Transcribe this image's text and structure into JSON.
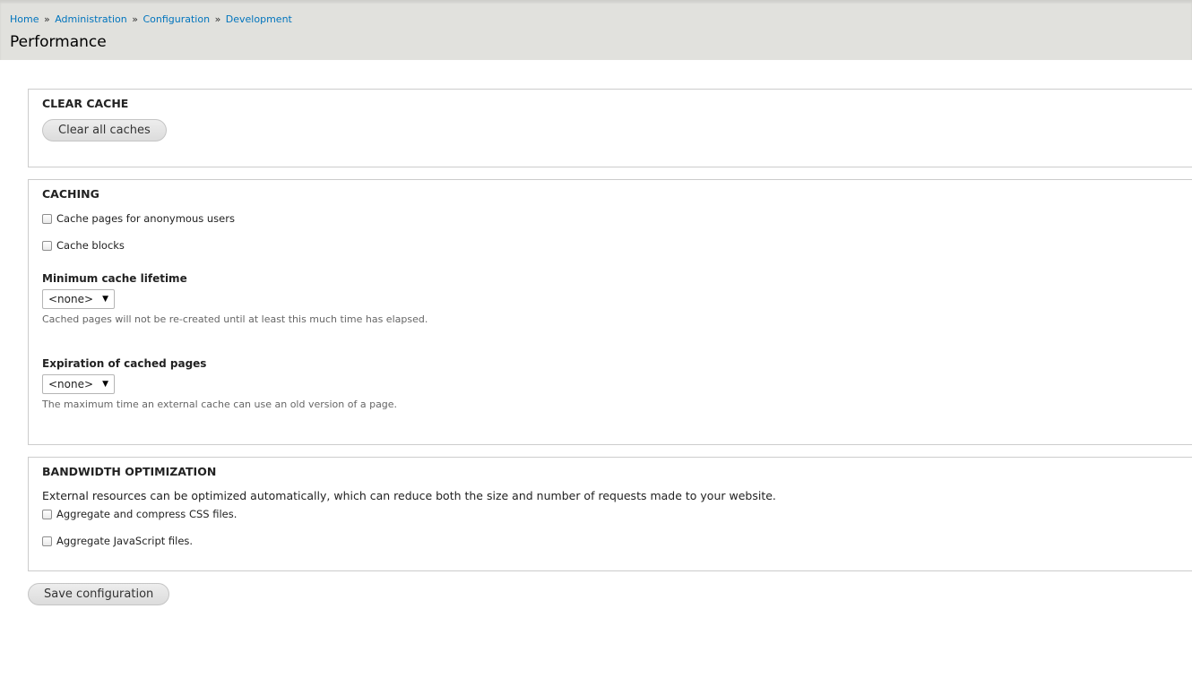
{
  "breadcrumb": {
    "items": [
      "Home",
      "Administration",
      "Configuration",
      "Development"
    ],
    "separator": "»"
  },
  "page_title": "Performance",
  "clear_cache": {
    "legend": "CLEAR CACHE",
    "button_label": "Clear all caches"
  },
  "caching": {
    "legend": "CACHING",
    "checkboxes": [
      {
        "label": "Cache pages for anonymous users",
        "checked": false
      },
      {
        "label": "Cache blocks",
        "checked": false
      }
    ],
    "min_lifetime": {
      "label": "Minimum cache lifetime",
      "value": "<none>",
      "description": "Cached pages will not be re-created until at least this much time has elapsed."
    },
    "expiration": {
      "label": "Expiration of cached pages",
      "value": "<none>",
      "description": "The maximum time an external cache can use an old version of a page."
    }
  },
  "bandwidth": {
    "legend": "BANDWIDTH OPTIMIZATION",
    "intro": "External resources can be optimized automatically, which can reduce both the size and number of requests made to your website.",
    "checkboxes": [
      {
        "label": "Aggregate and compress CSS files.",
        "checked": false
      },
      {
        "label": "Aggregate JavaScript files.",
        "checked": false
      }
    ]
  },
  "save_button_label": "Save configuration",
  "colors": {
    "link": "#0074bd",
    "header_bg": "#e1e1dd",
    "border": "#cccccc"
  }
}
